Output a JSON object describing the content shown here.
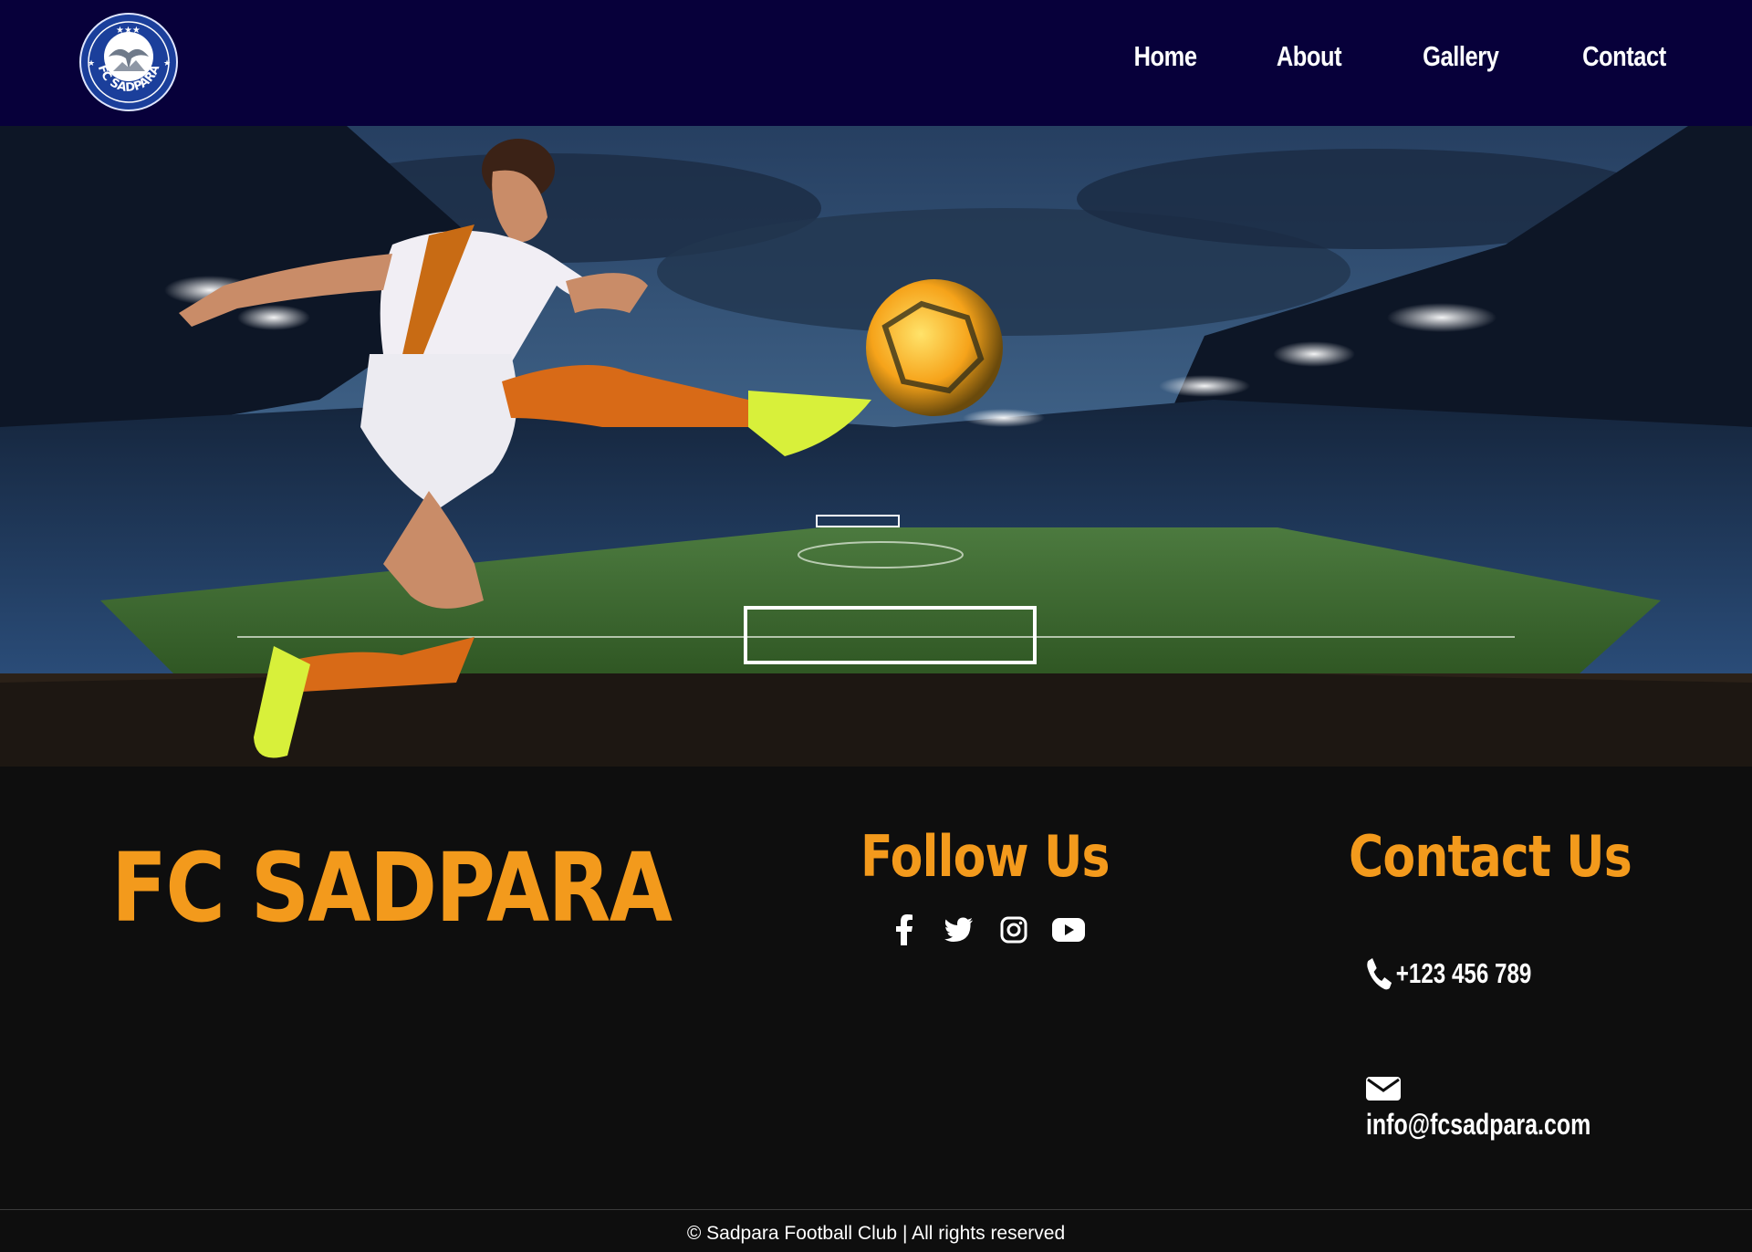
{
  "header": {
    "logo_text": "FC SADPARA",
    "nav": [
      "Home",
      "About",
      "Gallery",
      "Contact"
    ]
  },
  "footer": {
    "brand": "FC SADPARA",
    "follow_title": "Follow Us",
    "socials": [
      "facebook-icon",
      "twitter-icon",
      "instagram-icon",
      "youtube-icon"
    ],
    "contact_title": "Contact Us",
    "phone": "+123 456 789",
    "email": "info@fcsadpara.com",
    "copyright": "© Sadpara Football Club | All rights reserved"
  },
  "colors": {
    "header_bg": "#07003a",
    "footer_bg": "#0e0e0e",
    "accent": "#f39a1c"
  }
}
